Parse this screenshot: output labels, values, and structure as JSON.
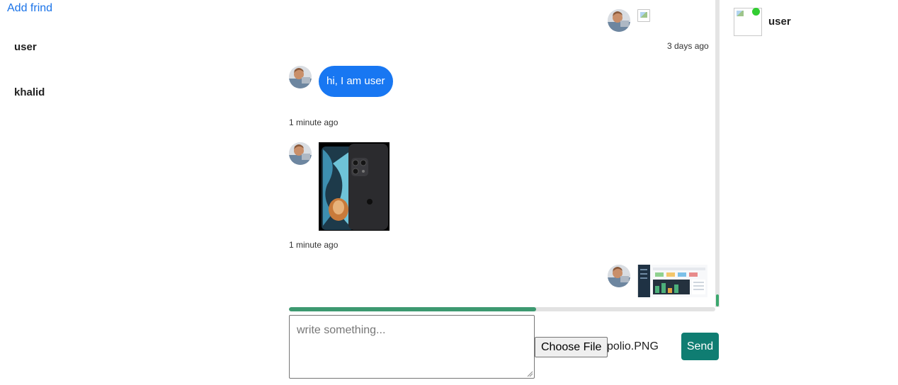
{
  "sidebar": {
    "add_friend_label": "Add frind",
    "friends": [
      "user",
      "khalid"
    ]
  },
  "chat": {
    "messages": [
      {
        "side": "right",
        "kind": "broken-image",
        "time": "3 days ago"
      },
      {
        "side": "left",
        "kind": "text",
        "text": "hi, I am user",
        "time": "1 minute ago"
      },
      {
        "side": "left",
        "kind": "image",
        "image": "smartphone-photo",
        "time": "1 minute ago"
      },
      {
        "side": "right",
        "kind": "image",
        "image": "dashboard-screenshot"
      }
    ]
  },
  "upload": {
    "progress_fraction": 0.58
  },
  "composer": {
    "placeholder": "write something...",
    "choose_file_label": "Choose File",
    "file_name": "polio.PNG",
    "send_label": "Send"
  },
  "right_panel": {
    "user_name": "user",
    "online_color": "#32cd32"
  },
  "colors": {
    "link": "#1a73e8",
    "bubble": "#1877f2",
    "send": "#0f7d72",
    "progress": "#3d9970"
  },
  "icons": {
    "avatar": "profile-photo-icon",
    "broken": "broken-image-icon"
  }
}
